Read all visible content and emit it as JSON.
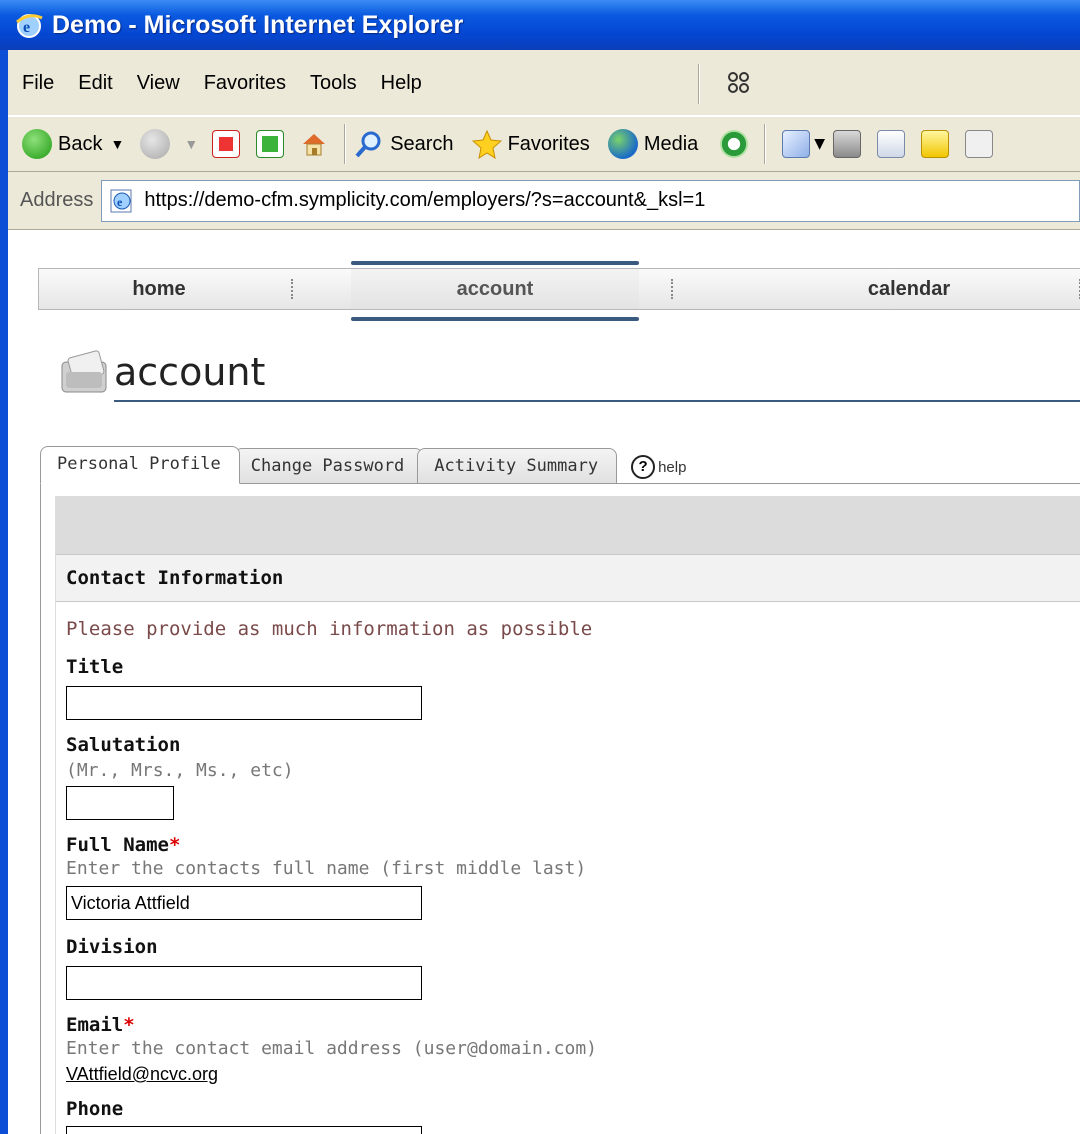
{
  "window": {
    "title": "Demo - Microsoft Internet Explorer"
  },
  "menu": {
    "items": [
      {
        "label": "File"
      },
      {
        "label": "Edit"
      },
      {
        "label": "View"
      },
      {
        "label": "Favorites"
      },
      {
        "label": "Tools"
      },
      {
        "label": "Help"
      }
    ]
  },
  "toolbar": {
    "back_label": "Back",
    "search_label": "Search",
    "favorites_label": "Favorites",
    "media_label": "Media"
  },
  "address": {
    "label": "Address",
    "url": "https://demo-cfm.symplicity.com/employers/?s=account&_ksl=1"
  },
  "nav": {
    "home": "home",
    "account": "account",
    "calendar": "calendar"
  },
  "page": {
    "title": "account"
  },
  "tabs": [
    {
      "label": "Personal Profile"
    },
    {
      "label": "Change Password"
    },
    {
      "label": "Activity Summary"
    }
  ],
  "help_label": "help",
  "section": {
    "title": "Contact Information",
    "intro": "Please provide as much information as possible"
  },
  "fields": {
    "title": {
      "label": "Title",
      "value": ""
    },
    "salutation": {
      "label": "Salutation",
      "hint": "(Mr., Mrs., Ms., etc)",
      "value": ""
    },
    "full_name": {
      "label": "Full Name",
      "required": "*",
      "hint": "Enter the contacts full name (first middle last)",
      "value": "Victoria Attfield"
    },
    "division": {
      "label": "Division",
      "value": ""
    },
    "email": {
      "label": "Email",
      "required": "*",
      "hint": "Enter the contact email address (user@domain.com)",
      "value": "VAttfield@ncvc.org"
    },
    "phone": {
      "label": "Phone",
      "value": ""
    }
  },
  "colors": {
    "titlebar": "#0546d1",
    "nav_accent": "#3a5a80",
    "required": "#dd0000",
    "intro_text": "#7a4a4a"
  }
}
